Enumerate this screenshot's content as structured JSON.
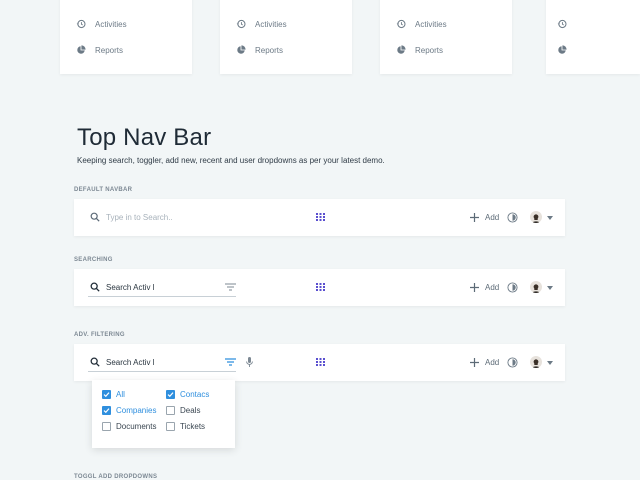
{
  "cards": [
    {
      "activities_label": "Activities",
      "reports_label": "Reports"
    },
    {
      "activities_label": "Activities",
      "reports_label": "Reports"
    },
    {
      "activities_label": "Activities",
      "reports_label": "Reports"
    },
    {
      "activities_label": "",
      "reports_label": ""
    }
  ],
  "page": {
    "title": "Top Nav Bar",
    "subtitle": "Keeping search, toggler, add new, recent and user dropdowns as per your latest demo."
  },
  "sections": {
    "default": {
      "label": "DEFAULT NAVBAR",
      "search_placeholder": "Type in to Search..",
      "add_label": "Add"
    },
    "searching": {
      "label": "SEARCHING",
      "search_value": "Search Activ l",
      "add_label": "Add"
    },
    "adv": {
      "label": "ADV. FILTERING",
      "search_value": "Search Activ l",
      "add_label": "Add"
    },
    "toggle": {
      "label": "TOGGL ADD DROPDOWNS"
    }
  },
  "filter_options": [
    {
      "label": "All",
      "checked": true
    },
    {
      "label": "Contacs",
      "checked": true
    },
    {
      "label": "Companies",
      "checked": true
    },
    {
      "label": "Deals",
      "checked": false
    },
    {
      "label": "Documents",
      "checked": false
    },
    {
      "label": "Tickets",
      "checked": false
    }
  ],
  "colors": {
    "accent": "#2f8fde",
    "grid_icon": "#5a4fcf",
    "background": "#f2f6f7"
  },
  "icons": [
    "history-icon",
    "pie-chart-icon",
    "search-icon",
    "apps-grid-icon",
    "plus-icon",
    "recent-icon",
    "avatar",
    "chevron-down-icon",
    "filter-icon",
    "mic-icon",
    "checkbox-icon"
  ]
}
